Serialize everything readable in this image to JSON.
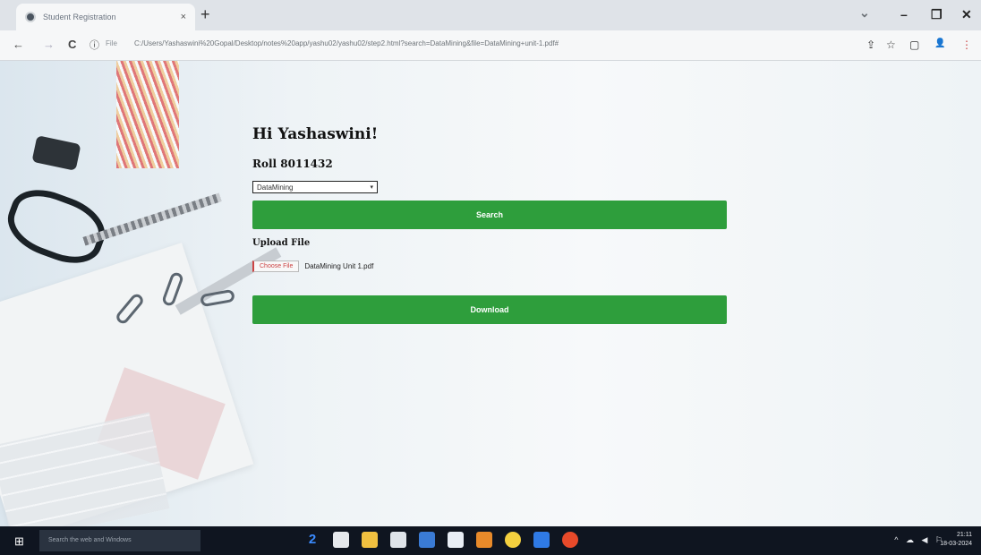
{
  "browser": {
    "tab_title": "Student Registration",
    "tab_close": "×",
    "new_tab": "+",
    "url_info": "File",
    "url": "C:/Users/Yashaswini%20Gopal/Desktop/notes%20app/yashu02/yashu02/step2.html?search=DataMining&file=DataMining+unit-1.pdf#",
    "back": "←",
    "forward": "→",
    "reload": "C",
    "info_icon": "ⓘ",
    "minimize": "–",
    "maximize": "❐",
    "close": "✕",
    "chevron": "⌄",
    "share": "⇪",
    "star": "☆",
    "sidebar": "▢",
    "profile": "👤",
    "menu": "⋮"
  },
  "page": {
    "greeting": "Hi Yashaswini!",
    "roll": "Roll 8011432",
    "subject_select": {
      "selected": "DataMining",
      "arrow": "▾"
    },
    "search_button": "Search",
    "upload_label": "Upload File",
    "choose_file_button": "Choose File",
    "file_name": "DataMining Unit 1.pdf",
    "download_button": "Download"
  },
  "taskbar": {
    "start_icon": "windows-icon",
    "search_placeholder": "Search the web and Windows",
    "tray_icons": "^ ☁ ◀ ⚐",
    "time": "21:11",
    "date": "18-03-2024"
  },
  "colors": {
    "button_green": "#2e9e3c",
    "taskbar": "#0f1520"
  }
}
